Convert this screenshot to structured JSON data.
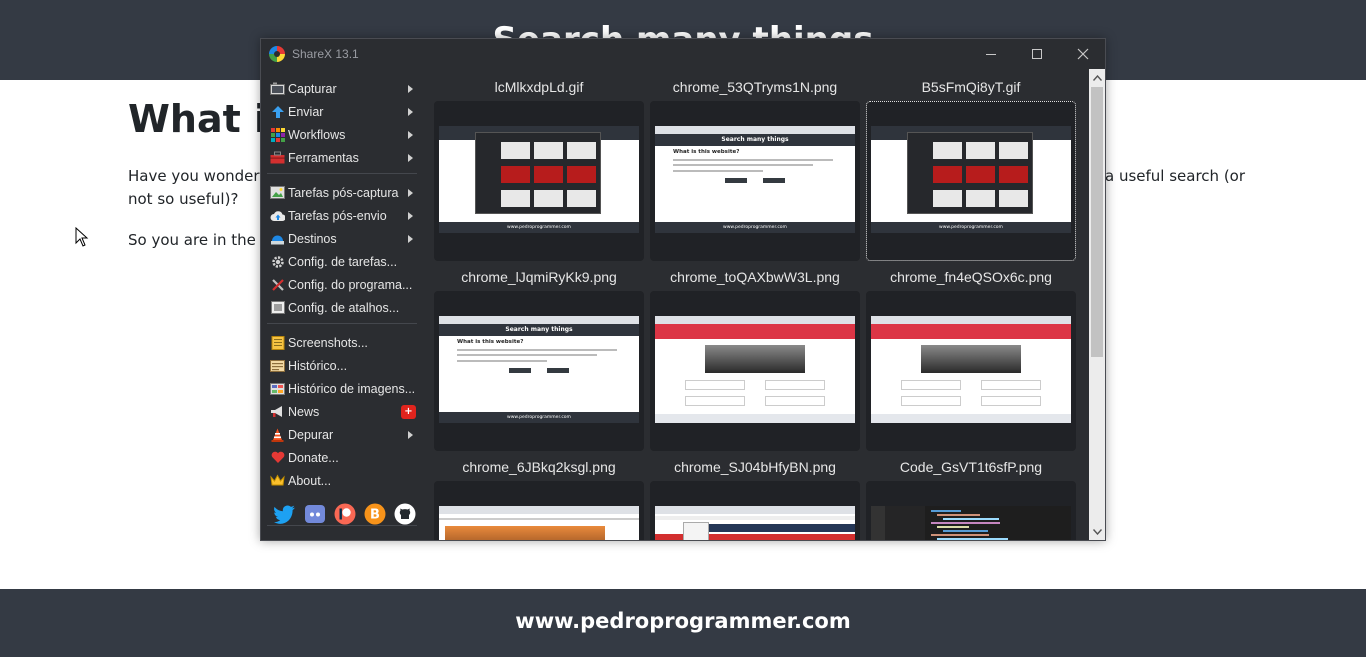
{
  "website": {
    "header_title": "Search many things",
    "heading": "What is",
    "paragraph1_start": "Have you wondere",
    "paragraph1_end": "a useful search (or",
    "paragraph1_line2": "not so useful)?",
    "paragraph2": "So you are in the ri",
    "footer": "www.pedroprogrammer.com"
  },
  "window": {
    "title": "ShareX 13.1",
    "minimize_icon": "minimize-icon",
    "maximize_icon": "maximize-icon",
    "close_icon": "close-icon"
  },
  "menu": {
    "items": [
      {
        "label": "Capturar",
        "icon": "camera-icon",
        "submenu": true
      },
      {
        "label": "Enviar",
        "icon": "upload-arrow-icon",
        "submenu": true
      },
      {
        "label": "Workflows",
        "icon": "workflows-grid-icon",
        "submenu": true
      },
      {
        "label": "Ferramentas",
        "icon": "toolbox-icon",
        "submenu": true
      },
      {
        "label": "Tarefas pós-captura",
        "icon": "image-task-icon",
        "submenu": true
      },
      {
        "label": "Tarefas pós-envio",
        "icon": "cloud-upload-icon",
        "submenu": true
      },
      {
        "label": "Destinos",
        "icon": "destinations-icon",
        "submenu": true
      },
      {
        "label": "Config. de tarefas...",
        "icon": "gear-icon",
        "submenu": false
      },
      {
        "label": "Config. do programa...",
        "icon": "wrench-screwdriver-icon",
        "submenu": false
      },
      {
        "label": "Config. de atalhos...",
        "icon": "keyboard-icon",
        "submenu": false
      },
      {
        "label": "Screenshots...",
        "icon": "folder-icon",
        "submenu": false
      },
      {
        "label": "Histórico...",
        "icon": "history-icon",
        "submenu": false
      },
      {
        "label": "Histórico de imagens...",
        "icon": "image-history-icon",
        "submenu": false
      },
      {
        "label": "News",
        "icon": "megaphone-icon",
        "submenu": false,
        "badge": "+"
      },
      {
        "label": "Depurar",
        "icon": "traffic-cone-icon",
        "submenu": true
      },
      {
        "label": "Donate...",
        "icon": "heart-icon",
        "submenu": false
      },
      {
        "label": "About...",
        "icon": "crown-icon",
        "submenu": false
      }
    ],
    "social": [
      "twitter-icon",
      "discord-icon",
      "patreon-icon",
      "bitcoin-icon",
      "github-icon"
    ]
  },
  "thumbnails": [
    {
      "filename": "lcMlkxdpLd.gif",
      "kind": "sharex",
      "selected": false
    },
    {
      "filename": "chrome_53QTryms1N.png",
      "kind": "website",
      "selected": false
    },
    {
      "filename": "B5sFmQi8yT.gif",
      "kind": "sharex",
      "selected": true
    },
    {
      "filename": "chrome_lJqmiRyKk9.png",
      "kind": "website",
      "selected": false
    },
    {
      "filename": "chrome_toQAXbwW3L.png",
      "kind": "photo",
      "selected": false
    },
    {
      "filename": "chrome_fn4eQSOx6c.png",
      "kind": "photo",
      "selected": false
    },
    {
      "filename": "chrome_6JBkq2ksgl.png",
      "kind": "sunset",
      "selected": false
    },
    {
      "filename": "chrome_SJ04bHfyBN.png",
      "kind": "sheet",
      "selected": false
    },
    {
      "filename": "Code_GsVT1t6sfP.png",
      "kind": "code",
      "selected": false
    }
  ],
  "thumbnail_text": {
    "site_title": "Search many things",
    "site_heading": "What is this website?",
    "site_footer": "www.pedroprogrammer.com"
  },
  "scrollbar": {
    "up_icon": "scroll-up-arrow-icon",
    "down_icon": "scroll-down-arrow-icon"
  }
}
